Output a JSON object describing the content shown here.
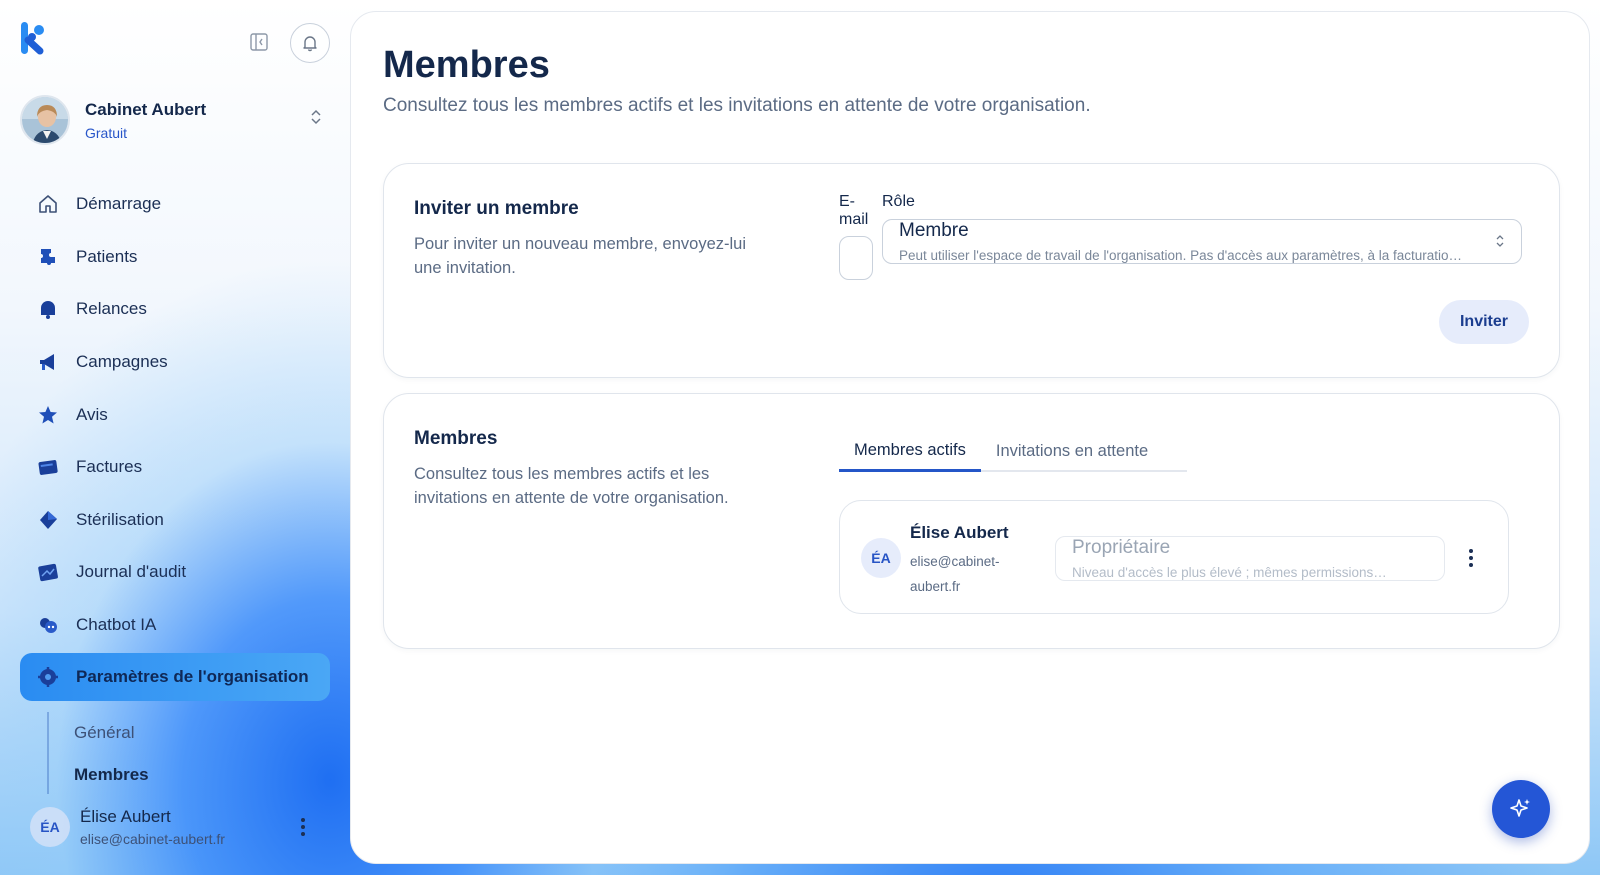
{
  "app": {
    "logo_letter": "k"
  },
  "organization": {
    "name": "Cabinet Aubert",
    "plan": "Gratuit"
  },
  "nav": {
    "items": [
      {
        "label": "Démarrage",
        "icon": "home-icon"
      },
      {
        "label": "Patients",
        "icon": "puzzle-icon"
      },
      {
        "label": "Relances",
        "icon": "bell-icon"
      },
      {
        "label": "Campagnes",
        "icon": "megaphone-icon"
      },
      {
        "label": "Avis",
        "icon": "star-icon"
      },
      {
        "label": "Factures",
        "icon": "invoice-icon"
      },
      {
        "label": "Stérilisation",
        "icon": "diamond-icon"
      },
      {
        "label": "Journal d'audit",
        "icon": "journal-icon"
      },
      {
        "label": "Chatbot IA",
        "icon": "chatbot-icon"
      },
      {
        "label": "Paramètres de l'organisation",
        "icon": "settings-icon",
        "active": true
      }
    ],
    "subitems": [
      {
        "label": "Général"
      },
      {
        "label": "Membres",
        "current": true
      }
    ]
  },
  "user": {
    "initials": "ÉA",
    "name": "Élise Aubert",
    "email": "elise@cabinet-aubert.fr"
  },
  "page": {
    "title": "Membres",
    "subtitle": "Consultez tous les membres actifs et les invitations en attente de votre organisation."
  },
  "invite": {
    "title": "Inviter un membre",
    "description": "Pour inviter un nouveau membre, envoyez-lui une invitation.",
    "email_label": "E-mail",
    "email_value": "",
    "role_label": "Rôle",
    "role_value": "Membre",
    "role_description": "Peut utiliser l'espace de travail de l'organisation. Pas d'accès aux paramètres, à la facturation…",
    "button": "Inviter"
  },
  "members": {
    "title": "Membres",
    "description": "Consultez tous les membres actifs et les invitations en attente de votre organisation.",
    "tabs": [
      {
        "label": "Membres actifs",
        "active": true
      },
      {
        "label": "Invitations en attente",
        "active": false
      }
    ],
    "list": [
      {
        "initials": "ÉA",
        "name": "Élise Aubert",
        "email": "elise@cabinet-aubert.fr",
        "role": "Propriétaire",
        "role_description": "Niveau d'accès le plus élevé ; mêmes permissions…"
      }
    ]
  },
  "colors": {
    "accent": "#2456c8",
    "brand": "#2a8cf2",
    "text": "#14284b",
    "muted": "#5b6b84"
  }
}
